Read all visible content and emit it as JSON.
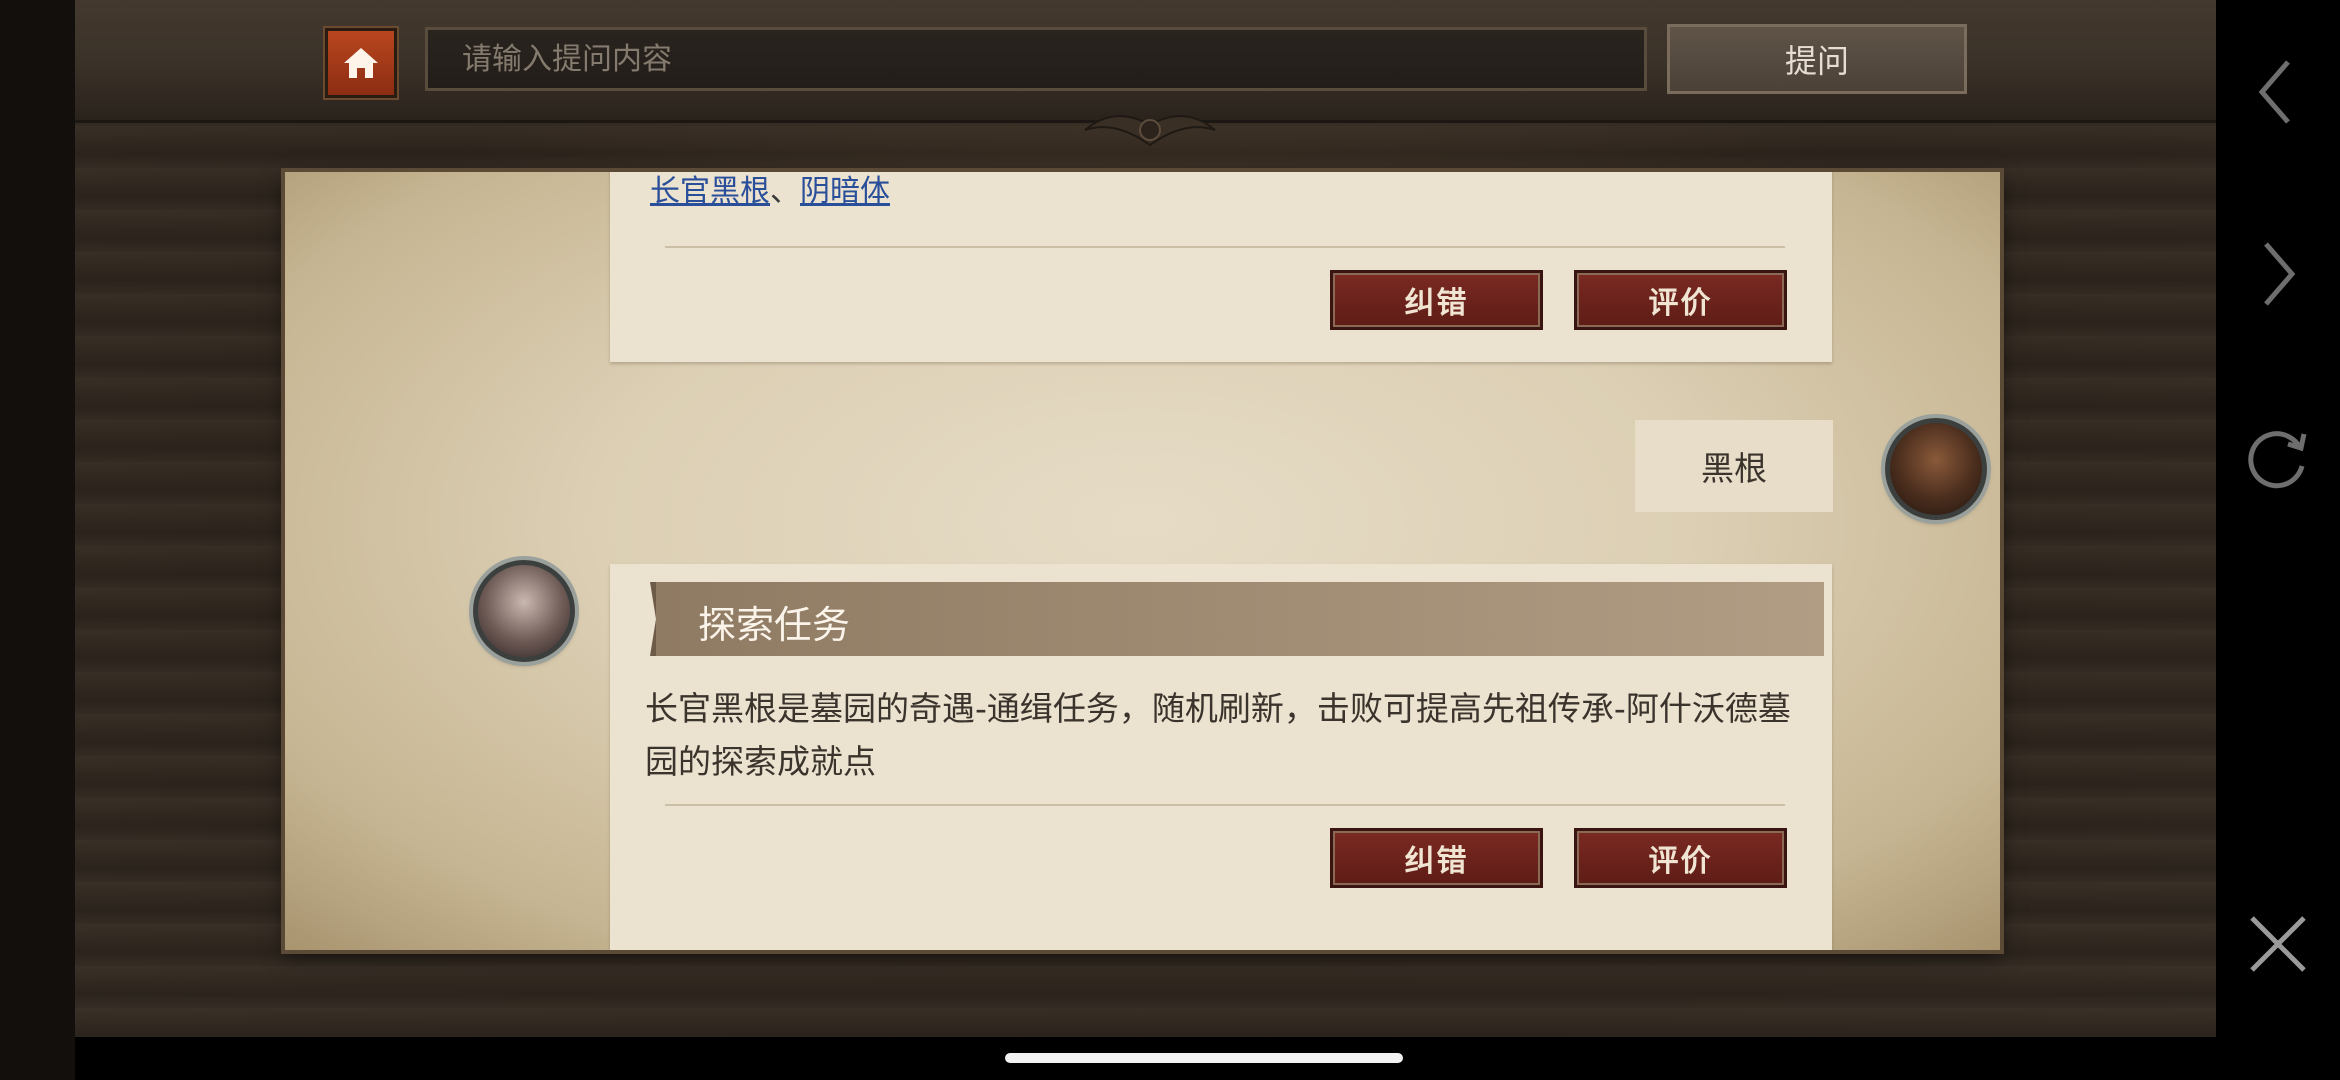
{
  "topbar": {
    "search_placeholder": "请输入提问内容",
    "ask_label": "提问"
  },
  "card1": {
    "links": [
      "长官黑根",
      "阴暗体"
    ],
    "separator": "、",
    "correct_label": "纠错",
    "rate_label": "评价"
  },
  "user_message": "黑根",
  "card2": {
    "title": "探索任务",
    "body": "长官黑根是墓园的奇遇-通缉任务，随机刷新，击败可提高先祖传承-阿什沃德墓园的探索成就点",
    "correct_label": "纠错",
    "rate_label": "评价"
  },
  "icons": {
    "home": "home-icon",
    "back": "chevron-left-icon",
    "forward": "chevron-right-icon",
    "refresh": "refresh-icon",
    "close": "close-icon"
  },
  "colors": {
    "home_button": "#a33a18",
    "red_button": "#6a221b",
    "link": "#2a4f9a",
    "parchment": "#e6dcc6"
  }
}
